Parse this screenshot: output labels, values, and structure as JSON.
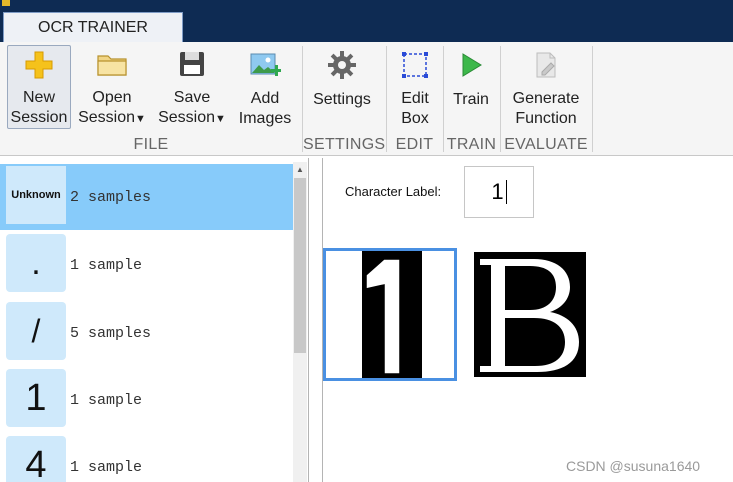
{
  "window": {
    "tab_label": "OCR TRAINER"
  },
  "ribbon": {
    "buttons": [
      {
        "id": "new-session",
        "line1": "New",
        "line2": "Session",
        "icon": "plus-icon"
      },
      {
        "id": "open-session",
        "line1": "Open",
        "line2": "Session",
        "icon": "folder-icon",
        "dropdown": true
      },
      {
        "id": "save-session",
        "line1": "Save",
        "line2": "Session",
        "icon": "floppy-disk-icon",
        "dropdown": true
      },
      {
        "id": "add-images",
        "line1": "Add",
        "line2": "Images",
        "icon": "add-image-icon"
      },
      {
        "id": "settings",
        "line1": "Settings",
        "line2": "",
        "icon": "gear-icon"
      },
      {
        "id": "edit-box",
        "line1": "Edit",
        "line2": "Box",
        "icon": "bounding-box-icon"
      },
      {
        "id": "train",
        "line1": "Train",
        "line2": "",
        "icon": "play-icon"
      },
      {
        "id": "generate-function",
        "line1": "Generate",
        "line2": "Function",
        "icon": "generate-function-icon"
      }
    ],
    "groups": [
      "FILE",
      "SETTINGS",
      "EDIT",
      "TRAIN",
      "EVALUATE"
    ]
  },
  "character_list": [
    {
      "label": "Unknown",
      "count": "2 samples"
    },
    {
      "label": ".",
      "count": "1 sample"
    },
    {
      "label": "/",
      "count": "5 samples"
    },
    {
      "label": "1",
      "count": "1 sample"
    },
    {
      "label": "4",
      "count": "1 sample"
    }
  ],
  "editor": {
    "character_label_caption": "Character Label:",
    "character_label_value": "1"
  },
  "watermark": "CSDN @susuna1640",
  "colors": {
    "title_bar": "#0e2b53",
    "selected_row": "#87cbfa",
    "thumbnail_bg": "#cfe9fb",
    "selection_border": "#4a90e2"
  }
}
